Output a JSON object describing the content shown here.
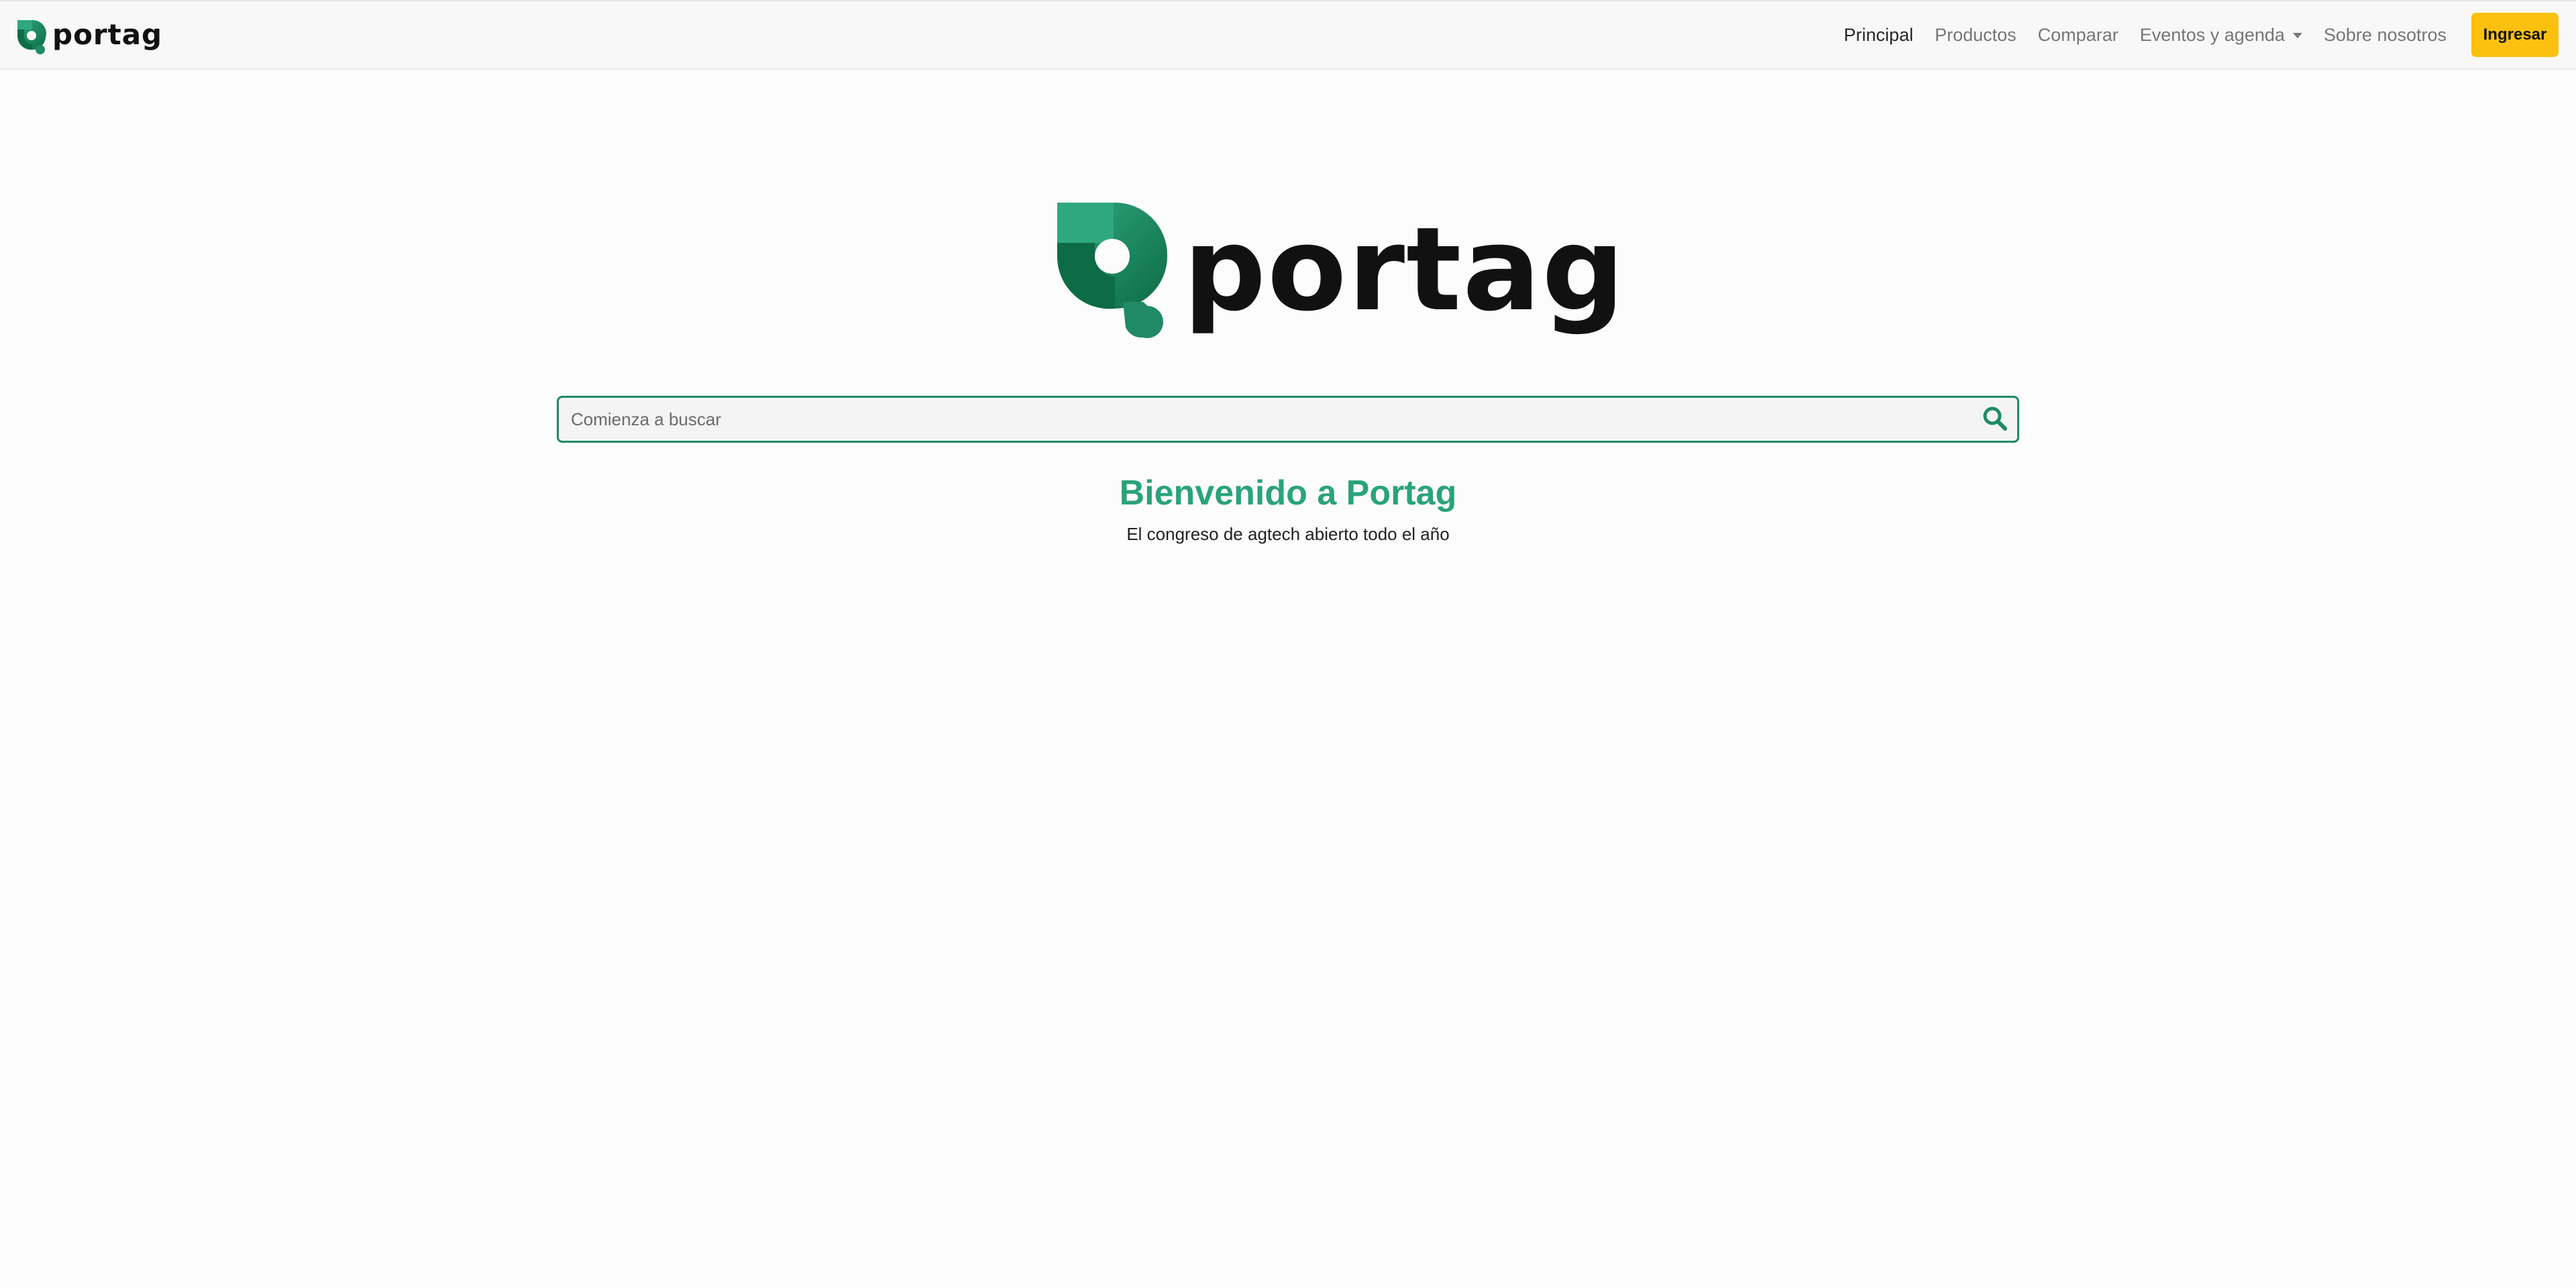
{
  "brand": {
    "name": "portag",
    "colors": {
      "green_light": "#2fa880",
      "green_dark": "#0d6b45",
      "text_dark": "#111111"
    }
  },
  "nav": {
    "items": [
      {
        "label": "Principal",
        "active": true
      },
      {
        "label": "Productos",
        "active": false
      },
      {
        "label": "Comparar",
        "active": false
      },
      {
        "label": "Eventos y agenda",
        "active": false,
        "dropdown": true
      },
      {
        "label": "Sobre nosotros",
        "active": false
      }
    ],
    "login_label": "Ingresar",
    "login_color": "#fcc10f"
  },
  "hero": {
    "logo_text": "portag"
  },
  "search": {
    "placeholder": "Comienza a buscar",
    "value": "",
    "icon": "search-icon",
    "border_color": "#1f8a65"
  },
  "welcome": {
    "title": "Bienvenido a Portag",
    "subtitle": "El congreso de agtech abierto todo el año",
    "title_color": "#2aa37a"
  }
}
